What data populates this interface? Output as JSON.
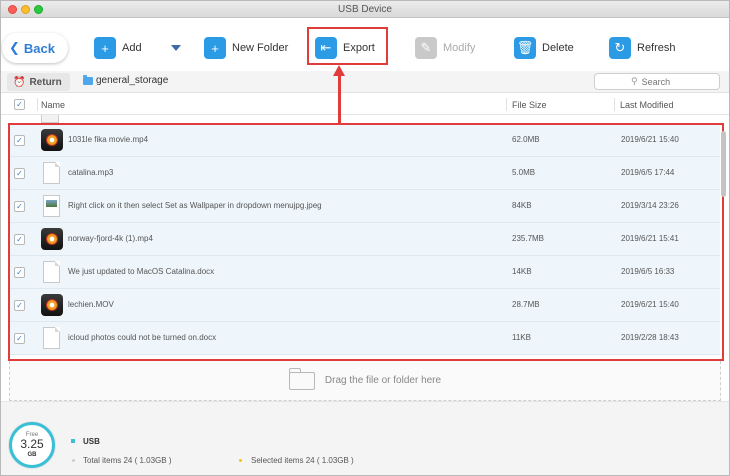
{
  "window": {
    "title": "USB Device"
  },
  "toolbar": {
    "back_label": "Back",
    "add_label": "Add",
    "new_folder_label": "New Folder",
    "export_label": "Export",
    "modify_label": "Modify",
    "delete_label": "Delete",
    "refresh_label": "Refresh"
  },
  "pathbar": {
    "return_label": "Return",
    "folder": "general_storage",
    "search_placeholder": "Search"
  },
  "columns": {
    "name": "Name",
    "size": "File Size",
    "date": "Last Modified"
  },
  "files": [
    {
      "name": "1031le fika movie.mp4",
      "size": "62.0MB",
      "date": "2019/6/21  15:40",
      "icon": "video-icon",
      "checked": true
    },
    {
      "name": "catalina.mp3",
      "size": "5.0MB",
      "date": "2019/6/5  17:44",
      "icon": "document-icon",
      "checked": true
    },
    {
      "name": "Right click on it then select Set as Wallpaper in dropdown menujpg.jpeg",
      "size": "84KB",
      "date": "2019/3/14  23:26",
      "icon": "jpeg-icon",
      "checked": true
    },
    {
      "name": "norway-fjord-4k (1).mp4",
      "size": "235.7MB",
      "date": "2019/6/21  15:41",
      "icon": "video-icon",
      "checked": true
    },
    {
      "name": "We just updated to MacOS Catalina.docx",
      "size": "14KB",
      "date": "2019/6/5  16:33",
      "icon": "document-icon",
      "checked": true
    },
    {
      "name": "lechien.MOV",
      "size": "28.7MB",
      "date": "2019/6/21  15:40",
      "icon": "video-icon",
      "checked": true
    },
    {
      "name": "icloud photos could not be turned on.docx",
      "size": "11KB",
      "date": "2019/2/28  18:43",
      "icon": "document-icon",
      "checked": true
    }
  ],
  "dropzone": {
    "label": "Drag the file or folder here"
  },
  "footer": {
    "free_label": "Free",
    "free_value": "3.25",
    "free_unit": "GB",
    "device_name": "USB",
    "total_text": "Total items 24 ( 1.03GB )",
    "selected_text": "Selected items 24 ( 1.03GB )"
  },
  "colors": {
    "accent": "#2f7fd6",
    "highlight": "#e03c3c",
    "storage": "#39c0d6"
  }
}
